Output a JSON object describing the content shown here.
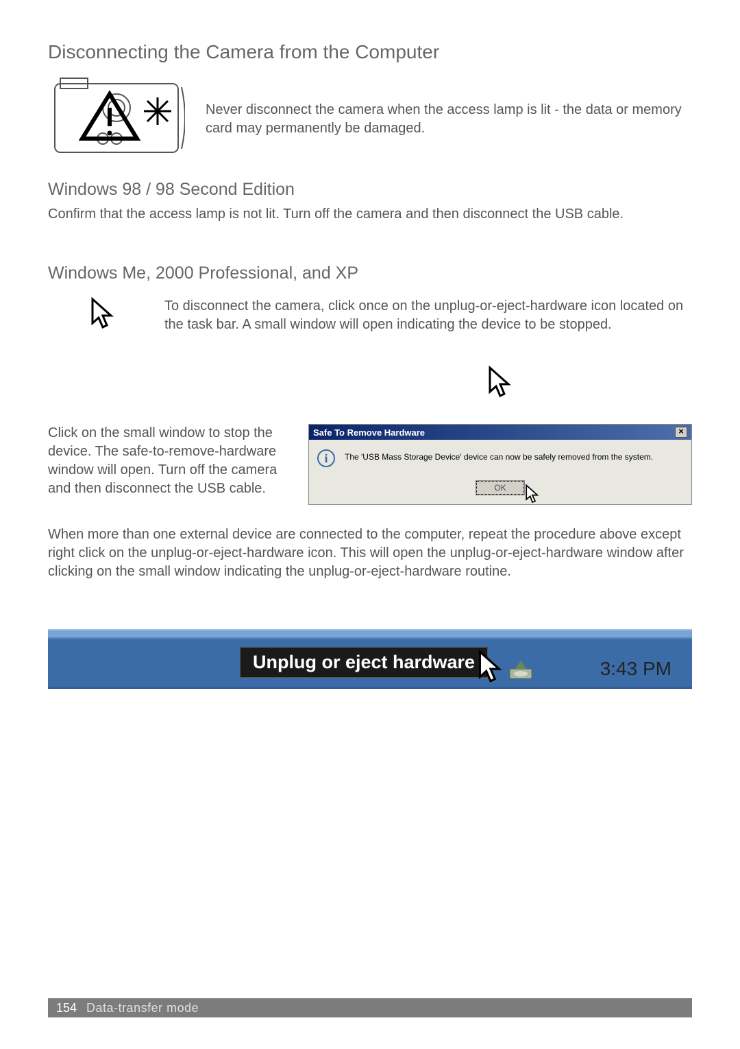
{
  "headings": {
    "main": "Disconnecting the Camera from the Computer",
    "win98": "Windows 98 / 98 Second Edition",
    "winme": "Windows Me, 2000 Professional, and XP"
  },
  "paragraphs": {
    "warning": "Never disconnect the camera when the access lamp is lit - the data or memory card may permanently be damaged.",
    "win98_body": "Confirm that the access lamp is not lit. Turn off the camera and then disconnect the USB cable.",
    "winme_intro": "To disconnect the camera, click once on the unplug-or-eject-hardware icon located on the task bar. A small window will open indicating the device to be stopped.",
    "click_small": "Click on the small window to stop the device. The safe-to-remove-hardware window will open. Turn off the camera and then disconnect the USB cable.",
    "multi_device": "When more than one external device are connected to the computer, repeat the procedure above except right click on the unplug-or-eject-hardware icon. This will open the unplug-or-eject-hardware window after clicking on the small window indicating the unplug-or-eject-hardware routine."
  },
  "dialog": {
    "title": "Safe To Remove Hardware",
    "message": "The 'USB Mass Storage Device' device can now be safely removed from the system.",
    "ok": "OK",
    "close_glyph": "×",
    "info_glyph": "i"
  },
  "taskbar": {
    "tooltip": "Unplug or eject hardware",
    "time": "3:43 PM"
  },
  "footer": {
    "page": "154",
    "section": "Data-transfer mode"
  }
}
